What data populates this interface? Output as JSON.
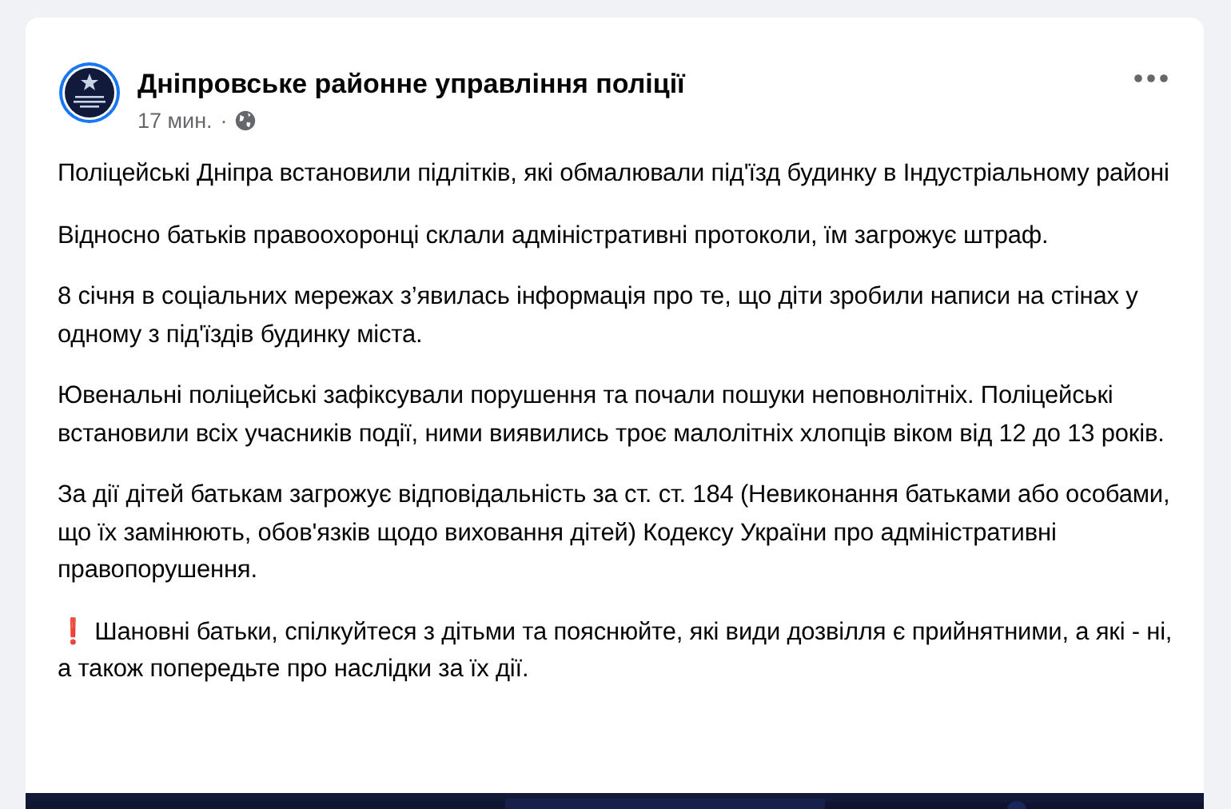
{
  "post": {
    "author": "Дніпровське районне управління поліції",
    "time": "17 мин.",
    "separator": "·",
    "paragraphs": [
      {
        "kind": "text",
        "text": "Поліцейські Дніпра встановили підлітків, які обмалювали під'їзд будинку в Індустріальному районі"
      },
      {
        "kind": "text",
        "text": "Відносно батьків правоохоронці склали адміністративні протоколи, їм загрожує штраф."
      },
      {
        "kind": "text",
        "text": "8 січня в соціальних мережах з’явилась інформація про те, що діти зробили написи на стінах у одному з під'їздів будинку міста."
      },
      {
        "kind": "text",
        "text": "Ювенальні поліцейські зафіксували порушення та почали пошуки неповнолітніх. Поліцейські встановили всіх учасників події, ними виявились троє малолітніх хлопців віком від 12 до 13 років."
      },
      {
        "kind": "text",
        "text": "За дії дітей батькам загрожує відповідальність за ст. ст. 184 (Невиконання батьками або особами, що їх замінюють, обов'язків щодо виховання дітей) Кодексу України про адміністративні правопорушення."
      },
      {
        "kind": "text",
        "text": "❗ Шановні батьки, спілкуйтеся з дітьми та пояснюйте, які види дозвілля є прийнятними, а які - ні, а також попередьте про наслідки за їх дії."
      }
    ]
  }
}
